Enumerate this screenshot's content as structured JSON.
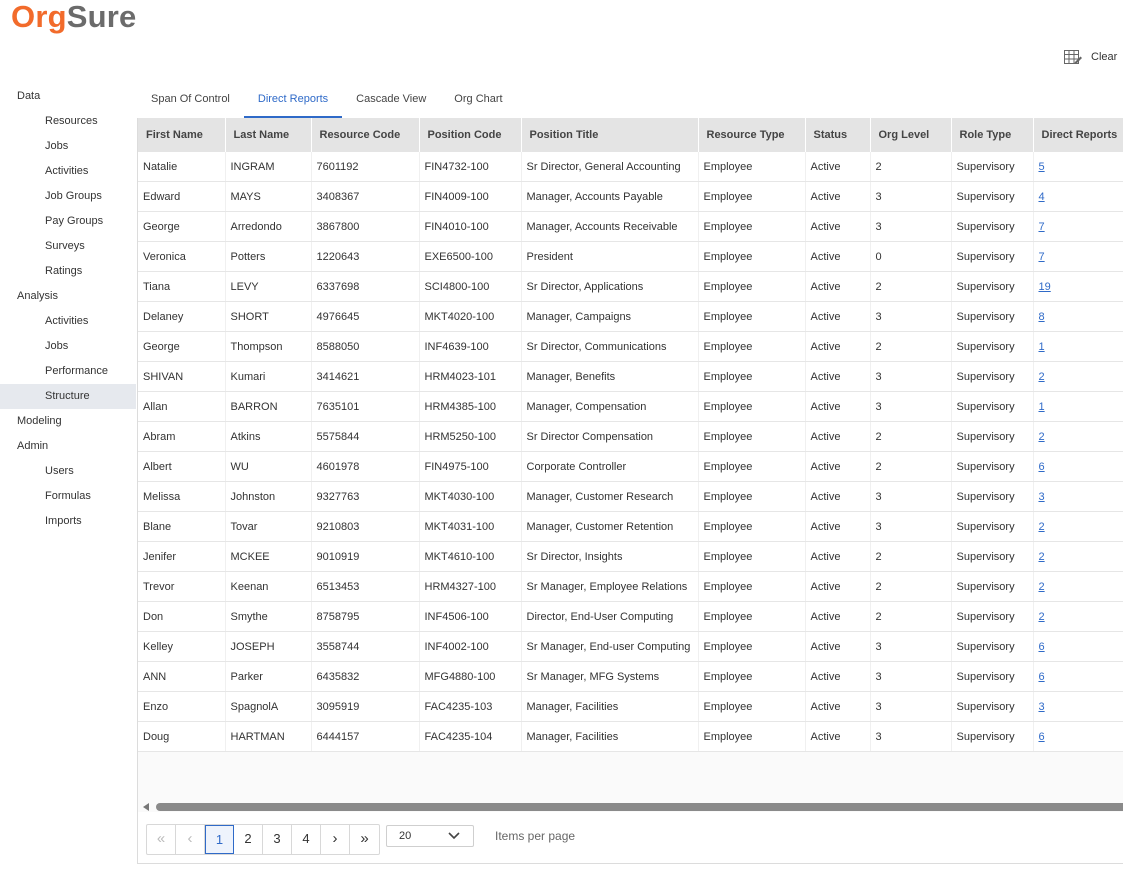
{
  "logo": {
    "part1": "Org",
    "part2": "Sure"
  },
  "toolbar": {
    "clear_label": "Clear"
  },
  "sidebar": {
    "data": {
      "label": "Data",
      "items": [
        "Resources",
        "Jobs",
        "Activities",
        "Job Groups",
        "Pay Groups",
        "Surveys",
        "Ratings"
      ]
    },
    "analysis": {
      "label": "Analysis",
      "items": [
        "Activities",
        "Jobs",
        "Performance",
        "Structure"
      ]
    },
    "modeling": {
      "label": "Modeling"
    },
    "admin": {
      "label": "Admin",
      "items": [
        "Users",
        "Formulas",
        "Imports"
      ]
    },
    "active_item": "Structure"
  },
  "tabs": [
    {
      "label": "Span Of Control",
      "active": false
    },
    {
      "label": "Direct Reports",
      "active": true
    },
    {
      "label": "Cascade View",
      "active": false
    },
    {
      "label": "Org Chart",
      "active": false
    }
  ],
  "table": {
    "columns": [
      "First Name",
      "Last Name",
      "Resource Code",
      "Position Code",
      "Position Title",
      "Resource Type",
      "Status",
      "Org Level",
      "Role Type",
      "Direct Reports"
    ],
    "rows": [
      [
        "Natalie",
        "INGRAM",
        "7601192",
        "FIN4732-100",
        "Sr Director, General Accounting",
        "Employee",
        "Active",
        "2",
        "Supervisory",
        "5"
      ],
      [
        "Edward",
        "MAYS",
        "3408367",
        "FIN4009-100",
        "Manager, Accounts Payable",
        "Employee",
        "Active",
        "3",
        "Supervisory",
        "4"
      ],
      [
        "George",
        "Arredondo",
        "3867800",
        "FIN4010-100",
        "Manager, Accounts Receivable",
        "Employee",
        "Active",
        "3",
        "Supervisory",
        "7"
      ],
      [
        "Veronica",
        "Potters",
        "1220643",
        "EXE6500-100",
        "President",
        "Employee",
        "Active",
        "0",
        "Supervisory",
        "7"
      ],
      [
        "Tiana",
        "LEVY",
        "6337698",
        "SCI4800-100",
        "Sr Director, Applications",
        "Employee",
        "Active",
        "2",
        "Supervisory",
        "19"
      ],
      [
        "Delaney",
        "SHORT",
        "4976645",
        "MKT4020-100",
        "Manager, Campaigns",
        "Employee",
        "Active",
        "3",
        "Supervisory",
        "8"
      ],
      [
        "George",
        "Thompson",
        "8588050",
        "INF4639-100",
        "Sr Director, Communications",
        "Employee",
        "Active",
        "2",
        "Supervisory",
        "1"
      ],
      [
        "SHIVAN",
        "Kumari",
        "3414621",
        "HRM4023-101",
        "Manager, Benefits",
        "Employee",
        "Active",
        "3",
        "Supervisory",
        "2"
      ],
      [
        "Allan",
        "BARRON",
        "7635101",
        "HRM4385-100",
        "Manager, Compensation",
        "Employee",
        "Active",
        "3",
        "Supervisory",
        "1"
      ],
      [
        "Abram",
        "Atkins",
        "5575844",
        "HRM5250-100",
        "Sr Director Compensation",
        "Employee",
        "Active",
        "2",
        "Supervisory",
        "2"
      ],
      [
        "Albert",
        "WU",
        "4601978",
        "FIN4975-100",
        "Corporate Controller",
        "Employee",
        "Active",
        "2",
        "Supervisory",
        "6"
      ],
      [
        "Melissa",
        "Johnston",
        "9327763",
        "MKT4030-100",
        "Manager, Customer Research",
        "Employee",
        "Active",
        "3",
        "Supervisory",
        "3"
      ],
      [
        "Blane",
        "Tovar",
        "9210803",
        "MKT4031-100",
        "Manager, Customer Retention",
        "Employee",
        "Active",
        "3",
        "Supervisory",
        "2"
      ],
      [
        "Jenifer",
        "MCKEE",
        "9010919",
        "MKT4610-100",
        "Sr Director, Insights",
        "Employee",
        "Active",
        "2",
        "Supervisory",
        "2"
      ],
      [
        "Trevor",
        "Keenan",
        "6513453",
        "HRM4327-100",
        "Sr Manager, Employee Relations",
        "Employee",
        "Active",
        "2",
        "Supervisory",
        "2"
      ],
      [
        "Don",
        "Smythe",
        "8758795",
        "INF4506-100",
        "Director, End-User Computing",
        "Employee",
        "Active",
        "2",
        "Supervisory",
        "2"
      ],
      [
        "Kelley",
        "JOSEPH",
        "3558744",
        "INF4002-100",
        "Sr Manager, End-user Computing",
        "Employee",
        "Active",
        "3",
        "Supervisory",
        "6"
      ],
      [
        "ANN",
        "Parker",
        "6435832",
        "MFG4880-100",
        "Sr Manager, MFG Systems",
        "Employee",
        "Active",
        "3",
        "Supervisory",
        "6"
      ],
      [
        "Enzo",
        "SpagnolA",
        "3095919",
        "FAC4235-103",
        "Manager, Facilities",
        "Employee",
        "Active",
        "3",
        "Supervisory",
        "3"
      ],
      [
        "Doug",
        "HARTMAN",
        "6444157",
        "FAC4235-104",
        "Manager, Facilities",
        "Employee",
        "Active",
        "3",
        "Supervisory",
        "6"
      ]
    ]
  },
  "pagination": {
    "first": "«",
    "prev": "‹",
    "next": "›",
    "last": "»",
    "pages": [
      "1",
      "2",
      "3",
      "4"
    ],
    "current": "1",
    "page_size": "20",
    "items_per_page_label": "Items per page"
  },
  "colors": {
    "accent": "#2f6ac8",
    "brand_orange": "#f26b2b",
    "brand_gray": "#6b6b6b"
  }
}
